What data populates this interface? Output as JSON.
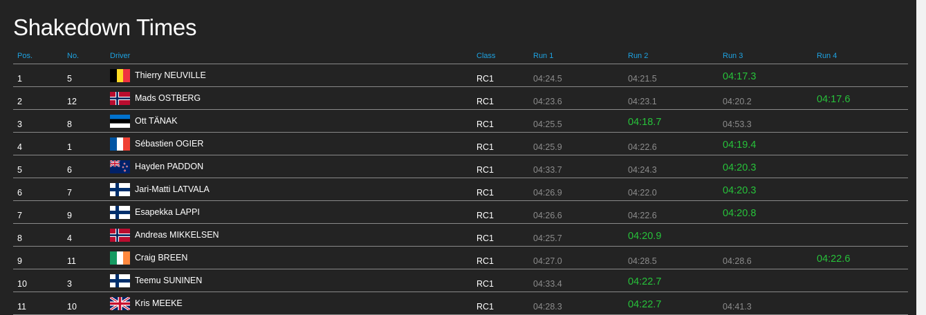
{
  "page": {
    "title": "Shakedown Times"
  },
  "table": {
    "columns": {
      "pos": "Pos.",
      "no": "No.",
      "driver": "Driver",
      "class": "Class",
      "run1": "Run 1",
      "run2": "Run 2",
      "run3": "Run 3",
      "run4": "Run 4"
    },
    "rows": [
      {
        "pos": "1",
        "no": "5",
        "driver": "Thierry NEUVILLE",
        "flag": "belgium-flag-icon",
        "class": "RC1",
        "run1": "04:24.5",
        "run2": "04:21.5",
        "run3": "04:17.3",
        "run4": "",
        "best": "run3"
      },
      {
        "pos": "2",
        "no": "12",
        "driver": "Mads OSTBERG",
        "flag": "norway-flag-icon",
        "class": "RC1",
        "run1": "04:23.6",
        "run2": "04:23.1",
        "run3": "04:20.2",
        "run4": "04:17.6",
        "best": "run4"
      },
      {
        "pos": "3",
        "no": "8",
        "driver": "Ott TÄNAK",
        "flag": "estonia-flag-icon",
        "class": "RC1",
        "run1": "04:25.5",
        "run2": "04:18.7",
        "run3": "04:53.3",
        "run4": "",
        "best": "run2"
      },
      {
        "pos": "4",
        "no": "1",
        "driver": "Sébastien OGIER",
        "flag": "france-flag-icon",
        "class": "RC1",
        "run1": "04:25.9",
        "run2": "04:22.6",
        "run3": "04:19.4",
        "run4": "",
        "best": "run3"
      },
      {
        "pos": "5",
        "no": "6",
        "driver": "Hayden PADDON",
        "flag": "new-zealand-flag-icon",
        "class": "RC1",
        "run1": "04:33.7",
        "run2": "04:24.3",
        "run3": "04:20.3",
        "run4": "",
        "best": "run3"
      },
      {
        "pos": "6",
        "no": "7",
        "driver": "Jari-Matti LATVALA",
        "flag": "finland-flag-icon",
        "class": "RC1",
        "run1": "04:26.9",
        "run2": "04:22.0",
        "run3": "04:20.3",
        "run4": "",
        "best": "run3"
      },
      {
        "pos": "7",
        "no": "9",
        "driver": "Esapekka LAPPI",
        "flag": "finland-flag-icon",
        "class": "RC1",
        "run1": "04:26.6",
        "run2": "04:22.6",
        "run3": "04:20.8",
        "run4": "",
        "best": "run3"
      },
      {
        "pos": "8",
        "no": "4",
        "driver": "Andreas MIKKELSEN",
        "flag": "norway-flag-icon",
        "class": "RC1",
        "run1": "04:25.7",
        "run2": "04:20.9",
        "run3": "",
        "run4": "",
        "best": "run2"
      },
      {
        "pos": "9",
        "no": "11",
        "driver": "Craig BREEN",
        "flag": "ireland-flag-icon",
        "class": "RC1",
        "run1": "04:27.0",
        "run2": "04:28.5",
        "run3": "04:28.6",
        "run4": "04:22.6",
        "best": "run4"
      },
      {
        "pos": "10",
        "no": "3",
        "driver": "Teemu SUNINEN",
        "flag": "finland-flag-icon",
        "class": "RC1",
        "run1": "04:33.4",
        "run2": "04:22.7",
        "run3": "",
        "run4": "",
        "best": "run2"
      },
      {
        "pos": "11",
        "no": "10",
        "driver": "Kris MEEKE",
        "flag": "uk-flag-icon",
        "class": "RC1",
        "run1": "04:28.3",
        "run2": "04:22.7",
        "run3": "04:41.3",
        "run4": "",
        "best": "run2"
      }
    ]
  },
  "colors": {
    "background": "#232323",
    "header_text": "#1ea3e2",
    "best_time": "#27c23a",
    "normal_time": "#8c8c8c",
    "divider": "#8a8a8a"
  }
}
